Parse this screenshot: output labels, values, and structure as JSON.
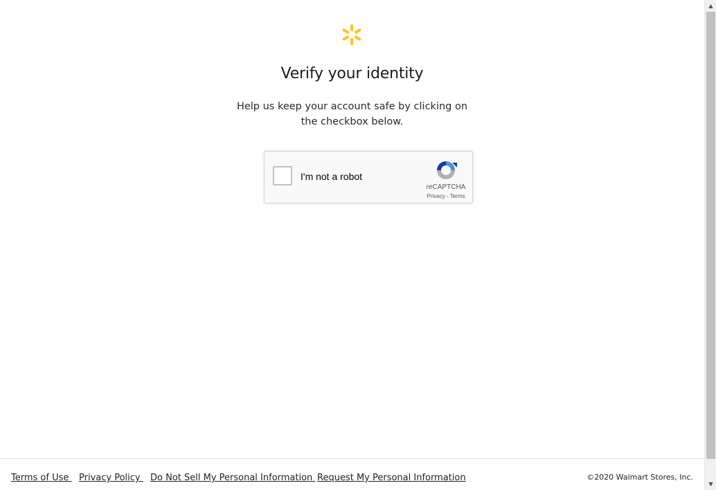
{
  "brand": {
    "logo_icon": "walmart-spark-icon",
    "logo_color": "#ffc220"
  },
  "page": {
    "title": "Verify your identity",
    "subtitle": "Help us keep your account safe by clicking on the checkbox below."
  },
  "recaptcha": {
    "checkbox_label": "I'm not a robot",
    "brand_text": "reCAPTCHA",
    "privacy_label": "Privacy",
    "separator": " - ",
    "terms_label": "Terms",
    "checked": false
  },
  "footer": {
    "links": [
      "Terms of Use ",
      "Privacy Policy ",
      "Do Not Sell My Personal Information ",
      "Request My Personal Information"
    ],
    "copyright": "©2020 Walmart Stores, Inc."
  },
  "scrollbar": {
    "up_arrow": "▲",
    "down_arrow": "▼"
  }
}
